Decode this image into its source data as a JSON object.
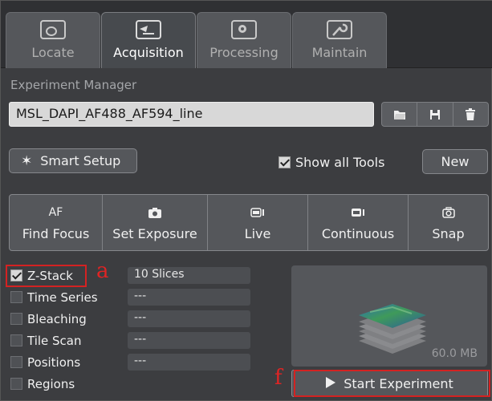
{
  "tabs": [
    {
      "label": "Locate",
      "icon": "locate-icon",
      "active": false
    },
    {
      "label": "Acquisition",
      "icon": "acquisition-icon",
      "active": true
    },
    {
      "label": "Processing",
      "icon": "processing-icon",
      "active": false
    },
    {
      "label": "Maintain",
      "icon": "maintain-icon",
      "active": false
    }
  ],
  "experiment_manager": {
    "label": "Experiment Manager",
    "selected_experiment": "MSL_DAPI_AF488_AF594_line",
    "icons": [
      "open-folder-icon",
      "save-icon",
      "delete-icon"
    ]
  },
  "smart_setup": {
    "label": "Smart Setup",
    "icon": "magic-wand-icon"
  },
  "show_all_tools": {
    "label": "Show all Tools",
    "checked": true
  },
  "new_button": {
    "label": "New"
  },
  "actions": [
    {
      "icon_text": "AF",
      "label": "Find Focus",
      "icon": "af-icon"
    },
    {
      "icon_text": "",
      "label": "Set Exposure",
      "icon": "camera-icon"
    },
    {
      "icon_text": "",
      "label": "Live",
      "icon": "live-camera-icon"
    },
    {
      "icon_text": "",
      "label": "Continuous",
      "icon": "continuous-camera-icon"
    },
    {
      "icon_text": "",
      "label": "Snap",
      "icon": "snap-camera-icon"
    }
  ],
  "dimensions": [
    {
      "label": "Z-Stack",
      "checked": true,
      "value": "10 Slices"
    },
    {
      "label": "Time Series",
      "checked": false,
      "value": "---"
    },
    {
      "label": "Bleaching",
      "checked": false,
      "value": "---"
    },
    {
      "label": "Tile Scan",
      "checked": false,
      "value": "---"
    },
    {
      "label": "Positions",
      "checked": false,
      "value": "---"
    },
    {
      "label": "Regions",
      "checked": false,
      "value": ""
    }
  ],
  "preview": {
    "size": "60.0 MB"
  },
  "start_button": {
    "label": "Start Experiment",
    "icon": "play-icon"
  },
  "annotations": {
    "a": "a",
    "f": "f"
  },
  "colors": {
    "highlight": "#d42222",
    "panel": "#3c3d40",
    "button": "#55575b"
  }
}
